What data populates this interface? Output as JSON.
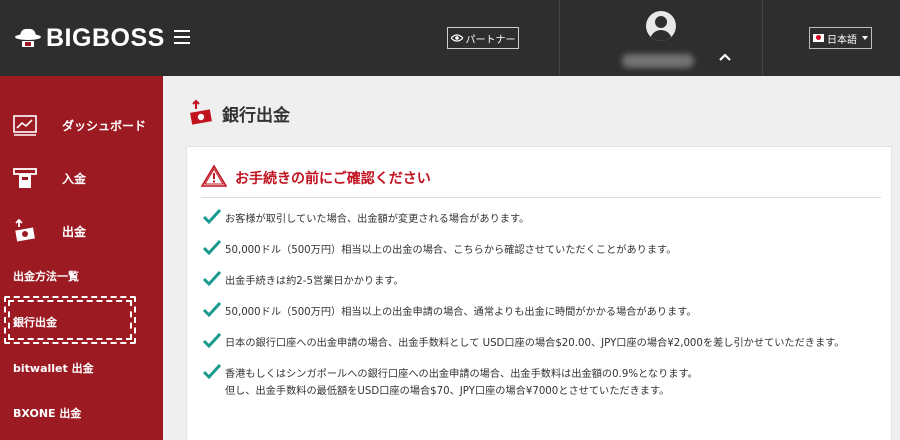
{
  "header": {
    "logo_text": "BIGBOSS",
    "partner_label": "パートナー",
    "language_label": "日本語"
  },
  "sidebar": {
    "items": [
      {
        "label": "ダッシュボード",
        "icon": "chart-icon"
      },
      {
        "label": "入金",
        "icon": "atm-card-icon"
      },
      {
        "label": "出金",
        "icon": "cash-withdraw-icon"
      }
    ],
    "sub_items": [
      {
        "label": "出金方法一覧"
      },
      {
        "label": "銀行出金",
        "active": true
      },
      {
        "label": "bitwallet 出金"
      },
      {
        "label": "BXONE 出金"
      }
    ]
  },
  "main": {
    "page_title": "銀行出金",
    "card_heading": "お手続きの前にご確認ください",
    "notices": [
      "お客様が取引していた場合、出金額が変更される場合があります。",
      "50,000ドル（500万円）相当以上の出金の場合、こちらから確認させていただくことがあります。",
      "出金手続きは約2-5営業日かかります。",
      "50,000ドル（500万円）相当以上の出金申請の場合、通常よりも出金に時間がかかる場合があります。",
      "日本の銀行口座への出金申請の場合、出金手数料として USD口座の場合$20.00、JPY口座の場合¥2,000を差し引かせていただきます。",
      "香港もしくはシンガポールへの銀行口座への出金申請の場合、出金手数料は出金額の0.9%となります。"
    ],
    "notice_6_sub": "但し、出金手数料の最低額をUSD口座の場合$70、JPY口座の場合¥7000とさせていただきます。"
  },
  "colors": {
    "sidebar_bg": "#9c1b23",
    "header_bg": "#2e2e2e",
    "accent_red": "#c0121f",
    "check_teal": "#1a9a8f"
  }
}
